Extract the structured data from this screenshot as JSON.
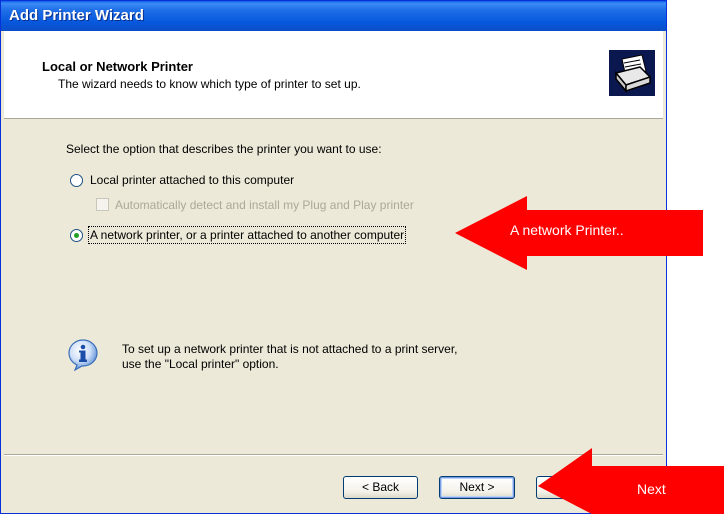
{
  "window": {
    "title": "Add Printer Wizard"
  },
  "header": {
    "title": "Local or Network Printer",
    "subtitle": "The wizard needs to know which type of printer to set up."
  },
  "body": {
    "prompt": "Select the option that describes the printer you want to use:",
    "options": [
      {
        "label": "Local printer attached to this computer",
        "selected": false
      },
      {
        "label": "A network printer, or a printer attached to another computer",
        "selected": true
      }
    ],
    "checkbox": {
      "label": "Automatically detect and install my Plug and Play printer",
      "checked": false,
      "enabled": false
    },
    "info": {
      "line1": "To set up a network printer that is not attached to a print server,",
      "line2": "use the \"Local printer\" option."
    }
  },
  "buttons": {
    "back": "< Back",
    "next": "Next >"
  },
  "annotations": {
    "network_callout": "A network Printer..",
    "next_callout": "Next",
    "color": "#ff0000"
  }
}
